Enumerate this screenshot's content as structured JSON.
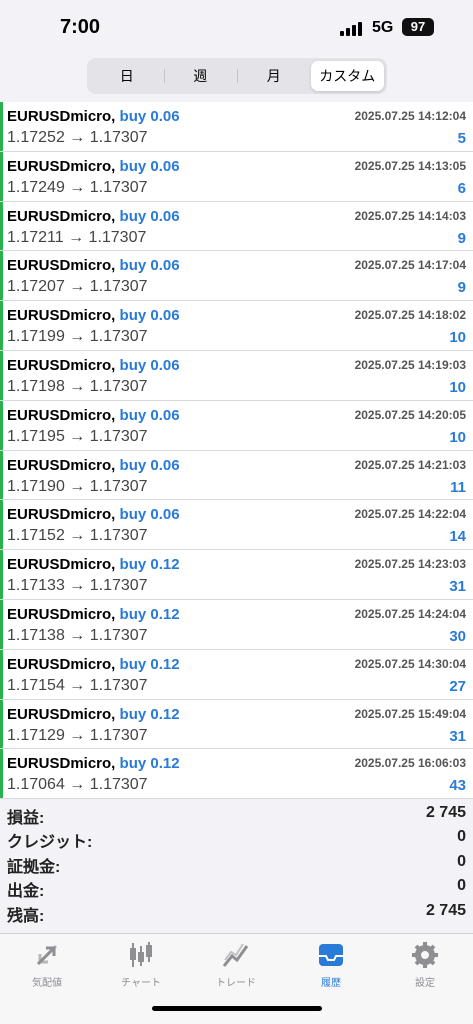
{
  "status": {
    "time": "7:00",
    "network": "5G",
    "battery": "97"
  },
  "segments": [
    {
      "label": "日"
    },
    {
      "label": "週"
    },
    {
      "label": "月"
    },
    {
      "label": "カスタム"
    }
  ],
  "deals": [
    {
      "symbol": "EURUSDmicro,",
      "side": "buy 0.06",
      "prices": "1.17252 → 1.17307",
      "time": "2025.07.25 14:12:04",
      "profit": "5"
    },
    {
      "symbol": "EURUSDmicro,",
      "side": "buy 0.06",
      "prices": "1.17249 → 1.17307",
      "time": "2025.07.25 14:13:05",
      "profit": "6"
    },
    {
      "symbol": "EURUSDmicro,",
      "side": "buy 0.06",
      "prices": "1.17211 → 1.17307",
      "time": "2025.07.25 14:14:03",
      "profit": "9"
    },
    {
      "symbol": "EURUSDmicro,",
      "side": "buy 0.06",
      "prices": "1.17207 → 1.17307",
      "time": "2025.07.25 14:17:04",
      "profit": "9"
    },
    {
      "symbol": "EURUSDmicro,",
      "side": "buy 0.06",
      "prices": "1.17199 → 1.17307",
      "time": "2025.07.25 14:18:02",
      "profit": "10"
    },
    {
      "symbol": "EURUSDmicro,",
      "side": "buy 0.06",
      "prices": "1.17198 → 1.17307",
      "time": "2025.07.25 14:19:03",
      "profit": "10"
    },
    {
      "symbol": "EURUSDmicro,",
      "side": "buy 0.06",
      "prices": "1.17195 → 1.17307",
      "time": "2025.07.25 14:20:05",
      "profit": "10"
    },
    {
      "symbol": "EURUSDmicro,",
      "side": "buy 0.06",
      "prices": "1.17190 → 1.17307",
      "time": "2025.07.25 14:21:03",
      "profit": "11"
    },
    {
      "symbol": "EURUSDmicro,",
      "side": "buy 0.06",
      "prices": "1.17152 → 1.17307",
      "time": "2025.07.25 14:22:04",
      "profit": "14"
    },
    {
      "symbol": "EURUSDmicro,",
      "side": "buy 0.12",
      "prices": "1.17133 → 1.17307",
      "time": "2025.07.25 14:23:03",
      "profit": "31"
    },
    {
      "symbol": "EURUSDmicro,",
      "side": "buy 0.12",
      "prices": "1.17138 → 1.17307",
      "time": "2025.07.25 14:24:04",
      "profit": "30"
    },
    {
      "symbol": "EURUSDmicro,",
      "side": "buy 0.12",
      "prices": "1.17154 → 1.17307",
      "time": "2025.07.25 14:30:04",
      "profit": "27"
    },
    {
      "symbol": "EURUSDmicro,",
      "side": "buy 0.12",
      "prices": "1.17129 → 1.17307",
      "time": "2025.07.25 15:49:04",
      "profit": "31"
    },
    {
      "symbol": "EURUSDmicro,",
      "side": "buy 0.12",
      "prices": "1.17064 → 1.17307",
      "time": "2025.07.25 16:06:03",
      "profit": "43"
    }
  ],
  "summary": [
    {
      "label": "損益:",
      "value": "2 745"
    },
    {
      "label": "クレジット:",
      "value": "0"
    },
    {
      "label": "証拠金:",
      "value": "0"
    },
    {
      "label": "出金:",
      "value": "0"
    },
    {
      "label": "残高:",
      "value": "2 745"
    }
  ],
  "tabs": [
    {
      "label": "気配値",
      "icon": "quotes-icon"
    },
    {
      "label": "チャート",
      "icon": "chart-icon"
    },
    {
      "label": "トレード",
      "icon": "trade-icon"
    },
    {
      "label": "履歴",
      "icon": "history-icon"
    },
    {
      "label": "設定",
      "icon": "settings-icon"
    }
  ],
  "colors": {
    "accent": "#2a7ad8",
    "buy_marker": "#27b24a",
    "inactive": "#8e8e93"
  }
}
